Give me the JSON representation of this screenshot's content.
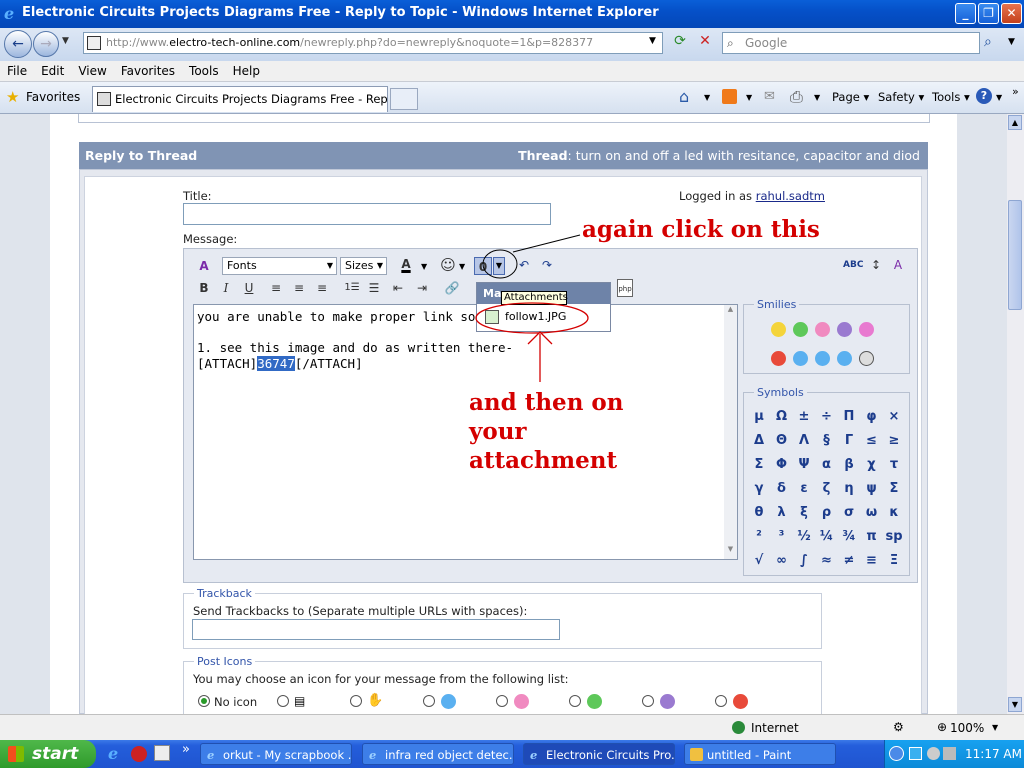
{
  "window": {
    "title": "Electronic Circuits Projects Diagrams Free - Reply to Topic - Windows Internet Explorer"
  },
  "address": {
    "prefix": "http://www.",
    "domain": "electro-tech-online.com",
    "path": "/newreply.php?do=newreply&noquote=1&p=828377"
  },
  "search": {
    "placeholder": "Google"
  },
  "menu": [
    "File",
    "Edit",
    "View",
    "Favorites",
    "Tools",
    "Help"
  ],
  "favorites_label": "Favorites",
  "tab": {
    "title": "Electronic Circuits Projects Diagrams Free - Reply to T..."
  },
  "commands": {
    "page": "Page",
    "safety": "Safety",
    "tools": "Tools"
  },
  "panel": {
    "heading": "Reply to Thread",
    "thread_label": "Thread",
    "thread_title": "turn on and off a led with resitance, capacitor and diod"
  },
  "form": {
    "title_label": "Title:",
    "logged_in_prefix": "Logged in as",
    "user": "rahul.sadtm",
    "message_label": "Message:",
    "fonts": "Fonts",
    "sizes": "Sizes"
  },
  "message": {
    "line1": "you are unable to make proper link so follo",
    "line2": "1. see this image and do as written there-",
    "attach_open": "[ATTACH]",
    "attach_id": "36747",
    "attach_close": "[/ATTACH]"
  },
  "attachments_menu": {
    "header": "Manage Attachments",
    "tooltip": "Attachments",
    "item": "follow1.JPG"
  },
  "annotations": {
    "top": "again click on this",
    "bottom1": "and then on",
    "bottom2": "your",
    "bottom3": "attachment"
  },
  "smilies_label": "Smilies",
  "symbols_label": "Symbols",
  "symbols": [
    "μ",
    "Ω",
    "±",
    "÷",
    "Π",
    "φ",
    "×",
    "Δ",
    "Θ",
    "Λ",
    "§",
    "Γ",
    "≤",
    "≥",
    "Σ",
    "Φ",
    "Ψ",
    "α",
    "β",
    "χ",
    "τ",
    "γ",
    "δ",
    "ε",
    "ζ",
    "η",
    "ψ",
    "Σ",
    "θ",
    "λ",
    "ξ",
    "ρ",
    "σ",
    "ω",
    "κ",
    "²",
    "³",
    "½",
    "¼",
    "¾",
    "π",
    "sp",
    "√",
    "∞",
    "∫",
    "≈",
    "≠",
    "≡",
    "Ξ"
  ],
  "trackback": {
    "legend": "Trackback",
    "label": "Send Trackbacks to (Separate multiple URLs with spaces):"
  },
  "post_icons": {
    "legend": "Post Icons",
    "label": "You may choose an icon for your message from the following list:",
    "no_icon": "No icon"
  },
  "status": {
    "zone": "Internet",
    "zoom": "100%"
  },
  "taskbar": {
    "start": "start",
    "tasks": [
      "orkut - My scrapbook ...",
      "infra red object detec...",
      "Electronic Circuits Pro...",
      "untitled - Paint"
    ],
    "clock": "11:17 AM"
  }
}
